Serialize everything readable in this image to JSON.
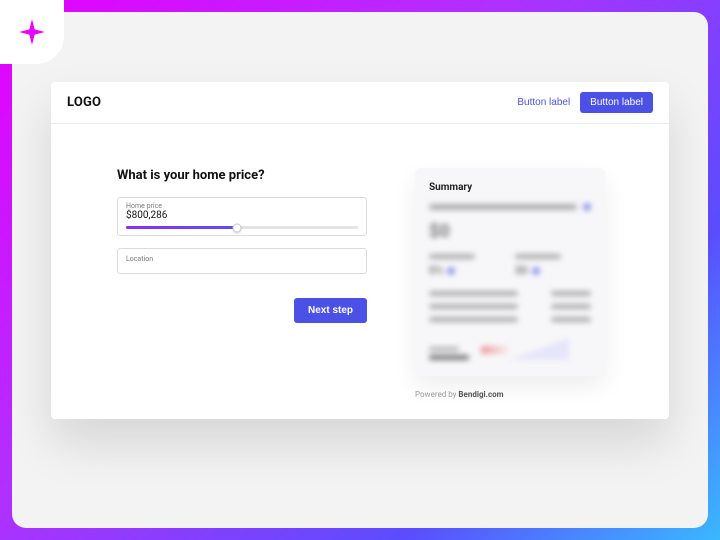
{
  "notch": {
    "icon": "sparkle-icon"
  },
  "header": {
    "logo": "LOGO",
    "link_label": "Button label",
    "primary_label": "Button label"
  },
  "form": {
    "heading": "What is your home price?",
    "home_price": {
      "label": "Home price",
      "value": "$800,286"
    },
    "location": {
      "label": "Location"
    },
    "next_label": "Next step"
  },
  "summary": {
    "title": "Summary",
    "big_value": "$0",
    "col1_value": "0%",
    "col2_value": "$0"
  },
  "footer": {
    "prefix": "Powered by ",
    "name": "Bendigi.com"
  }
}
